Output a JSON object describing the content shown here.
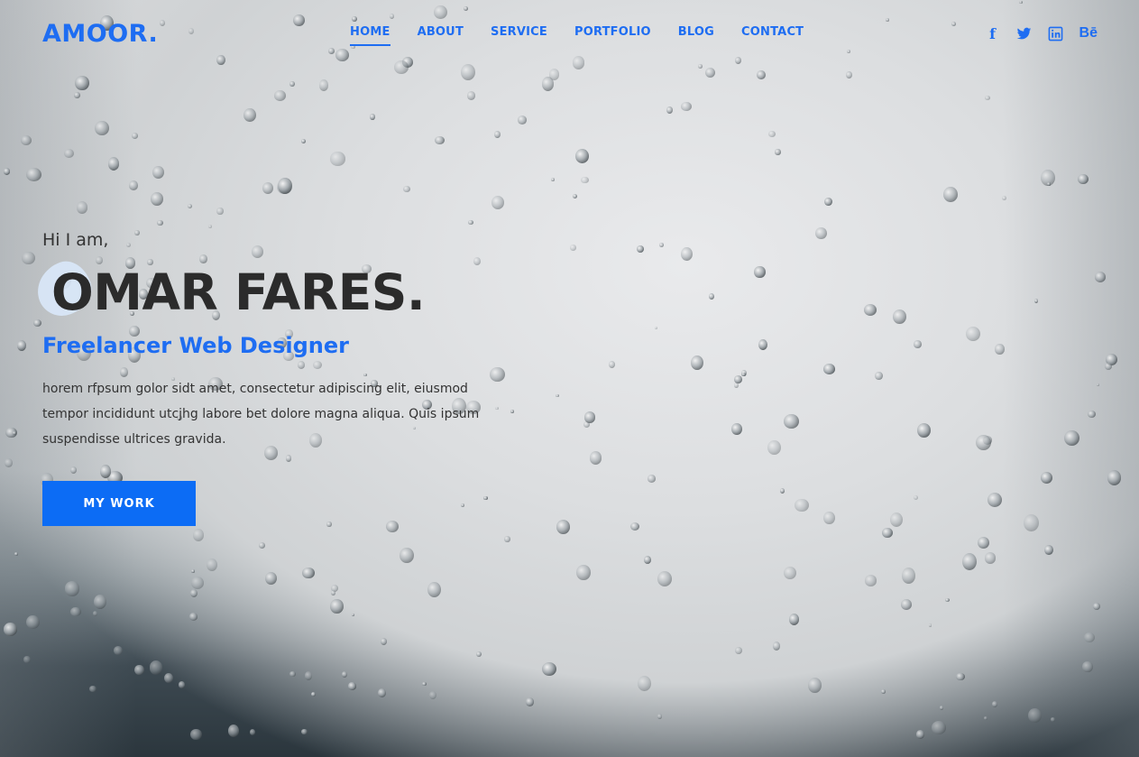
{
  "brand": {
    "logo": "AMOOR."
  },
  "nav": {
    "items": [
      "HOME",
      "ABOUT",
      "SERVICE",
      "PORTFOLIO",
      "BLOG",
      "CONTACT"
    ],
    "active": "HOME"
  },
  "social": [
    {
      "icon": "facebook-icon",
      "label": "f"
    },
    {
      "icon": "twitter-icon",
      "label": ""
    },
    {
      "icon": "linkedin-icon",
      "label": "in"
    },
    {
      "icon": "behance-icon",
      "label": "Bē"
    }
  ],
  "hero": {
    "greeting": "Hi I am,",
    "name": "OMAR FARES.",
    "role": "Freelancer Web Designer",
    "description": "horem rfpsum golor sidt amet, consectetur adipiscing elit, eiusmod tempor incididunt utcjhg labore bet dolore magna aliqua. Quis ipsum suspendisse ultrices gravida.",
    "cta_label": "MY WORK"
  },
  "colors": {
    "accent": "#1e6df2",
    "button": "#0c6cf5",
    "text": "#333333"
  }
}
